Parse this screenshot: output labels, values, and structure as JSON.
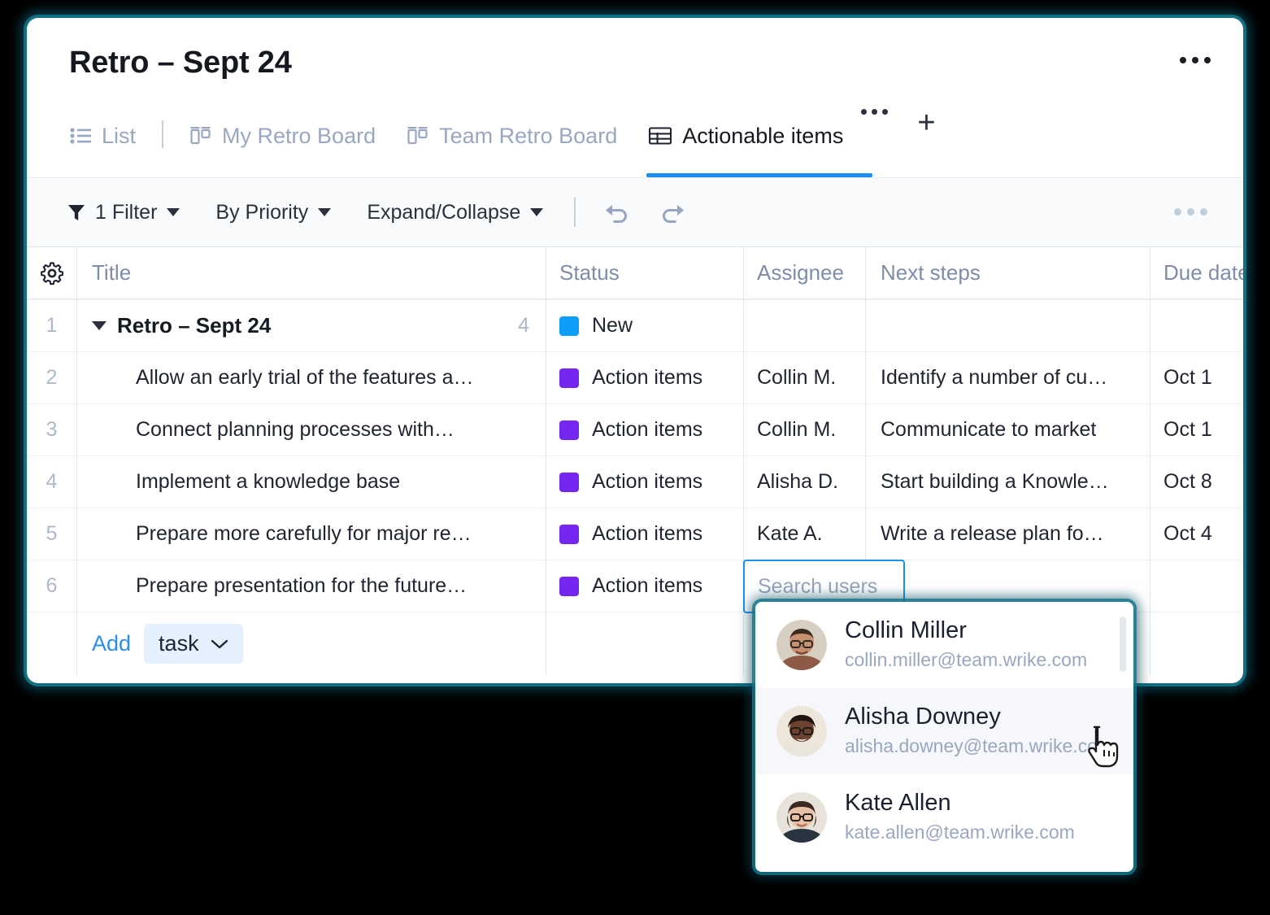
{
  "header": {
    "title": "Retro – Sept 24",
    "more_icon": "ellipsis-icon"
  },
  "tabs": [
    {
      "label": "List",
      "icon": "list-view-icon",
      "active": false
    },
    {
      "label": "My Retro Board",
      "icon": "board-view-icon",
      "active": false
    },
    {
      "label": "Team Retro Board",
      "icon": "board-view-icon",
      "active": false
    },
    {
      "label": "Actionable items",
      "icon": "table-view-icon",
      "active": true
    }
  ],
  "tab_controls": {
    "more_label": "tab-options",
    "add_label": "+"
  },
  "toolbar": {
    "filter_icon": "funnel-icon",
    "filter_label": "1 Filter",
    "sort_label": "By Priority",
    "expand_label": "Expand/Collapse",
    "undo_label": "undo-icon",
    "redo_label": "redo-icon",
    "more_label": "toolbar-more"
  },
  "table": {
    "gear_icon": "settings-gear-icon",
    "columns": [
      "Title",
      "Status",
      "Assignee",
      "Next steps",
      "Due date"
    ],
    "group_row": {
      "number": "1",
      "title": "Retro – Sept 24",
      "count": "4",
      "status": "New",
      "status_color": "#0f9dfb",
      "assignee": "",
      "next_steps": "",
      "due_date": ""
    },
    "rows": [
      {
        "number": "2",
        "title": "Allow an early trial of the features a…",
        "status": "Action items",
        "status_color": "#7526f0",
        "assignee": "Collin M.",
        "next_steps": "Identify a number of cu…",
        "due_date": "Oct 1"
      },
      {
        "number": "3",
        "title": "Connect planning processes with…",
        "status": "Action items",
        "status_color": "#7526f0",
        "assignee": "Collin M.",
        "next_steps": "Communicate to market",
        "due_date": "Oct 1"
      },
      {
        "number": "4",
        "title": "Implement a knowledge base",
        "status": "Action items",
        "status_color": "#7526f0",
        "assignee": "Alisha D.",
        "next_steps": "Start building a Knowle…",
        "due_date": "Oct 8"
      },
      {
        "number": "5",
        "title": "Prepare more carefully for major re…",
        "status": "Action items",
        "status_color": "#7526f0",
        "assignee": "Kate A.",
        "next_steps": "Write a release plan fo…",
        "due_date": "Oct 4"
      },
      {
        "number": "6",
        "title": "Prepare presentation for the future…",
        "status": "Action items",
        "status_color": "#7526f0",
        "assignee": "",
        "next_steps": "",
        "due_date": ""
      }
    ],
    "add_row": {
      "add_label": "Add",
      "type_label": "task"
    }
  },
  "assignee_search": {
    "placeholder": "Search users",
    "value": ""
  },
  "user_dropdown": {
    "items": [
      {
        "name": "Collin Miller",
        "email": "collin.miller@team.wrike.com",
        "hovered": false
      },
      {
        "name": "Alisha Downey",
        "email": "alisha.downey@team.wrike.co",
        "hovered": true
      },
      {
        "name": "Kate Allen",
        "email": "kate.allen@team.wrike.com",
        "hovered": false
      }
    ]
  },
  "colors": {
    "accent": "#1a91f0",
    "status_new": "#0f9dfb",
    "status_action": "#7526f0",
    "link": "#2c8ded"
  }
}
